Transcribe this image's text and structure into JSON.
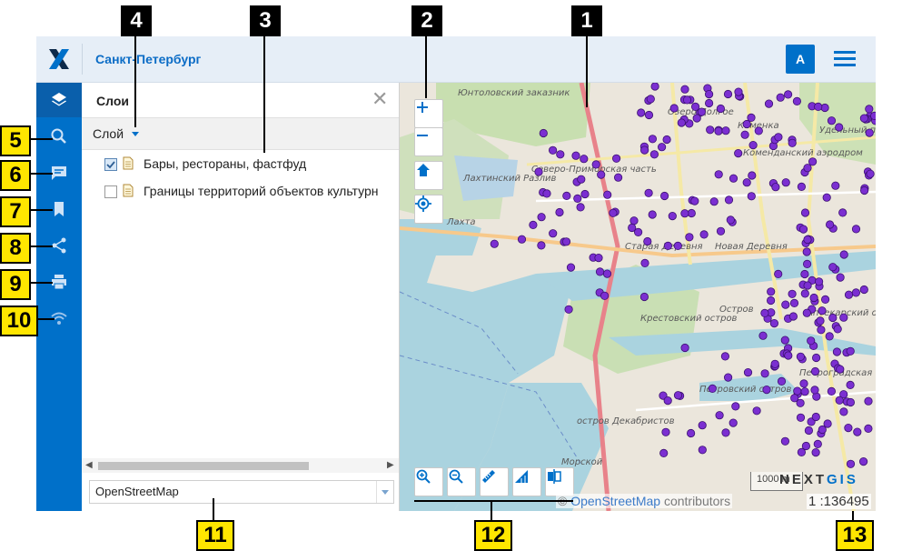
{
  "header": {
    "title": "Санкт-Петербург",
    "avatar_letter": "A",
    "colors": {
      "accent": "#0070c9",
      "header_bg": "#e6eef7"
    }
  },
  "sidebar": {
    "items": [
      {
        "icon": "layers-icon"
      },
      {
        "icon": "search-icon"
      },
      {
        "icon": "comment-icon"
      },
      {
        "icon": "bookmark-icon"
      },
      {
        "icon": "share-icon"
      },
      {
        "icon": "print-icon"
      },
      {
        "icon": "wifi-icon"
      }
    ]
  },
  "panel": {
    "title": "Слои",
    "toolbar_label": "Слой",
    "layers": [
      {
        "label": "Бары, рестораны, фастфуд",
        "checked": true
      },
      {
        "label": "Границы территорий объектов культурн",
        "checked": false
      }
    ],
    "basemap": "OpenStreetMap"
  },
  "map": {
    "labels": [
      "Юнтоловский заказник",
      "Озеро Долгое",
      "Каменка",
      "Коменданский аэродром",
      "Удельный парк",
      "Северо-Приморская часть",
      "Лахтинский Разлив",
      "Лахта",
      "Старая Деревня",
      "Новая Деревня",
      "Крестовский остров",
      "Остров",
      "Аптекарский остров",
      "Петровский остров",
      "Петроградская",
      "остров Декабристов",
      "Морской"
    ],
    "attribution_prefix": "© ",
    "attribution_link": "OpenStreetMap",
    "attribution_suffix": " contributors",
    "scale_text": "1 :136495",
    "scalebar_text": "1000 m",
    "brand": "NEXTGIS",
    "point_color": "#7b2fd1"
  },
  "callouts": [
    "1",
    "2",
    "3",
    "4",
    "5",
    "6",
    "7",
    "8",
    "9",
    "10",
    "11",
    "12",
    "13"
  ]
}
